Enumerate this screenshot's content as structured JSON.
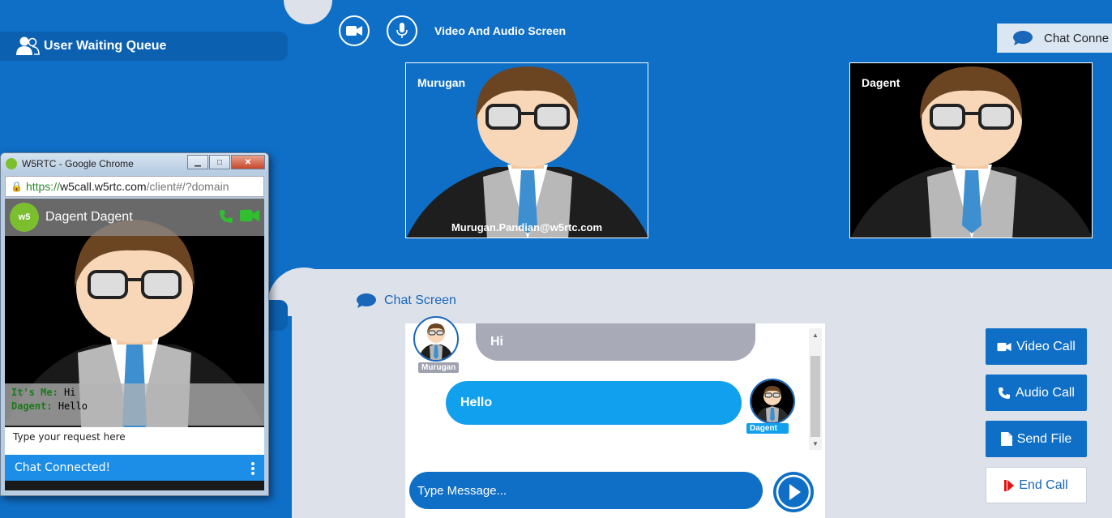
{
  "queue": {
    "title": "User Waiting Queue",
    "icon": "users-icon"
  },
  "media": {
    "title": "Video And Audio Screen",
    "video_icon": "video-camera-icon",
    "mic_icon": "microphone-icon"
  },
  "chat_connected_tab": {
    "label": "Chat Conne",
    "icon": "chat-bubble-icon"
  },
  "videos": {
    "local": {
      "name": "Murugan",
      "email": "Murugan.Pandian@w5rtc.com"
    },
    "remote": {
      "name": "Dagent"
    }
  },
  "chat": {
    "title": "Chat Screen",
    "messages": [
      {
        "sender": "Murugan",
        "text": "Hi"
      },
      {
        "sender": "Dagent",
        "text": "Hello"
      }
    ],
    "input_placeholder": "Type Message..."
  },
  "actions": {
    "video_call": "Video Call",
    "audio_call": "Audio Call",
    "send_file": "Send File",
    "end_call": "End Call"
  },
  "popup": {
    "window_title": "W5RTC - Google Chrome",
    "url_https": "https://",
    "url_host": "w5call.w5rtc.com",
    "url_path": "/client#/?domain",
    "agent_name": "Dagent Dagent",
    "brand_logo": "w5",
    "log": [
      {
        "who": "It's Me:",
        "text": "Hi"
      },
      {
        "who": "Dagent:",
        "text": "Hello"
      }
    ],
    "input_placeholder": "Type your request here",
    "status": "Chat Connected!"
  },
  "colors": {
    "primary": "#0f6fc6",
    "bubble_incoming": "#a8aab8",
    "bubble_outgoing": "#11a0ee",
    "end_call_icon": "#e01515"
  }
}
